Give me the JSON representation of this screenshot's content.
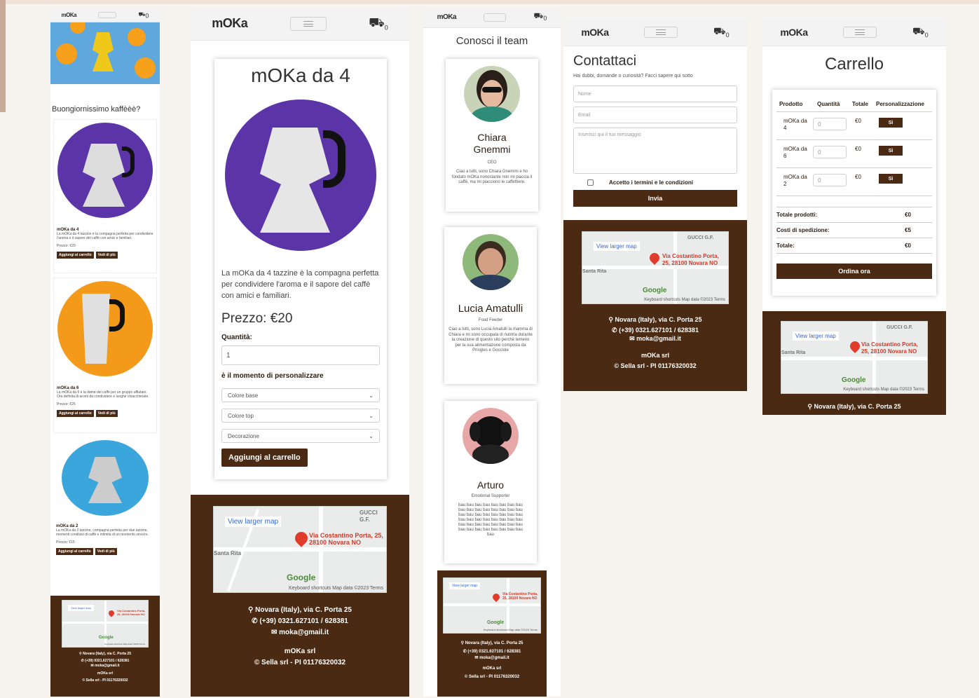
{
  "brand": "mOKa",
  "cart_count": "0",
  "home": {
    "tagline": "Buongiornissimo kaffèèè?",
    "products": [
      {
        "title": "mOKa da 4",
        "desc": "La mOKa da 4 tazzine è la compagna perfetta per condividere l'aroma e il sapore del caffè con amici e familiari.",
        "price": "Prezzo: €20",
        "add": "Aggiungi al carrello",
        "more": "Vedi di più"
      },
      {
        "title": "mOKa da 6",
        "desc": "La mOKa da 6 è la dama del caffè per un gruppo affiatato. Ora definita di aromi da condividere e lunghe chiacchierate.",
        "price": "Prezzo: €25",
        "add": "Aggiungi al carrello",
        "more": "Vedi di più"
      },
      {
        "title": "mOKa da 2",
        "desc": "La mOKa da 2 tazzine, compagna perfetta per due tazzine, momenti condivisi di caffè e intimità di un momento sincero.",
        "price": "Prezzo: €15",
        "add": "Aggiungi al carrello",
        "more": "Vedi di più"
      }
    ]
  },
  "product": {
    "title": "mOKa da 4",
    "desc": "La mOKa da 4 tazzine è la compagna perfetta per condividere l'aroma e il sapore del caffè con amici e familiari.",
    "price": "Prezzo: €20",
    "qty_label": "Quantità:",
    "qty_value": "1",
    "custom_label": "è il momento di personalizzare",
    "select1": "Colore base",
    "select2": "Colore top",
    "select3": "Decorazione",
    "add_btn": "Aggiungi al carrello"
  },
  "team": {
    "title": "Conosci il team",
    "members": [
      {
        "name": "Chiara Gnemmi",
        "role": "CEO",
        "bio": "Ciao a tutti, sono Chiara Gnemmi e ho fondato mOKa nonostante non mi piaccia il caffè, ma mi piacciono le caffettiere."
      },
      {
        "name": "Lucia Amatulli",
        "role": "Food Feeder",
        "bio": "Ciao a tutti, sono Lucia Amatulli la mamma di Chiara e mi sono occupata di nutrirla durante la creazione di questo sito perché temevo per la sua alimentazione composta da Pringles e Gocciole"
      },
      {
        "name": "Arturo",
        "role": "Emotional Supporter",
        "bio": "bau bau bau bau bau bau bau bau bau bau bau bau bau bau bau bau bau bau bau bau bau bau bau bau bau bau bau bau bau bau bau bau bau bau bau bau bau bau bau bau bau bau bau bau bau bau bau bau bau"
      }
    ]
  },
  "contact": {
    "title": "Contattaci",
    "subtitle": "Hai dubbi, domande o curiosità? Facci sapere qui sotto",
    "name_ph": "Nome",
    "email_ph": "Email",
    "msg_ph": "Inserisci qui il tuo messaggio",
    "terms": "Accetto i termini e le condizioni",
    "send": "Invia"
  },
  "cart_page": {
    "title": "Carrello",
    "headers": [
      "Prodotto",
      "Quantità",
      "Totale",
      "Personalizzazione"
    ],
    "rows": [
      {
        "product": "mOKa da 4",
        "qty": "0",
        "total": "€0",
        "btn": "Sì"
      },
      {
        "product": "mOKa da 6",
        "qty": "0",
        "total": "€0",
        "btn": "Sì"
      },
      {
        "product": "mOKa da 2",
        "qty": "0",
        "total": "€0",
        "btn": "Sì"
      }
    ],
    "summary": [
      {
        "label": "Totale prodotti:",
        "value": "€0"
      },
      {
        "label": "Costi di spedizione:",
        "value": "€5"
      },
      {
        "label": "Totale:",
        "value": "€0"
      }
    ],
    "order_btn": "Ordina ora"
  },
  "footer": {
    "address": "Novara (Italy), via C. Porta 25",
    "phone": "(+39) 0321.627101 / 628381",
    "email": "moka@gmail.it",
    "company": "mOKa srl",
    "copyright": "© Sella srl - PI 01176320032"
  },
  "map": {
    "link": "View larger map",
    "addr": "Via Costantino Porta, 25, 28100 Novara NO",
    "google": "Google",
    "terms": "Keyboard shortcuts   Map data ©2023   Terms",
    "poi1": "GUCCI G.F.",
    "poi2": "Santa Rita"
  },
  "colors": {
    "brown": "#4a2a12",
    "purple": "#5b35a8",
    "orange": "#f39a1a",
    "blue": "#3aa6dc"
  }
}
